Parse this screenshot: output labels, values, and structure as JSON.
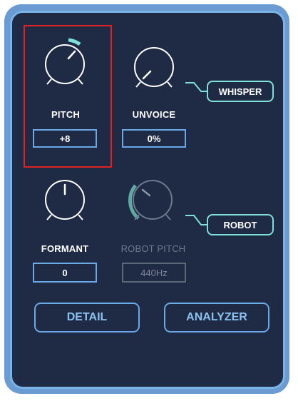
{
  "colors": {
    "panel_bg": "#1f2a44",
    "panel_border": "#7ab3e8",
    "accent_teal": "#7ee0d8",
    "value_box_border": "#6aa8e6",
    "button_text": "#8cc2f0",
    "selection": "#e02222"
  },
  "pitch": {
    "label": "PITCH",
    "value": "+8"
  },
  "unvoice": {
    "label": "UNVOICE",
    "value": "0%"
  },
  "formant": {
    "label": "FORMANT",
    "value": "0"
  },
  "robot_pitch": {
    "label": "ROBOT PITCH",
    "value": "440Hz"
  },
  "toggles": {
    "whisper": "WHISPER",
    "robot": "ROBOT"
  },
  "buttons": {
    "detail": "DETAIL",
    "analyzer": "ANALYZER"
  }
}
